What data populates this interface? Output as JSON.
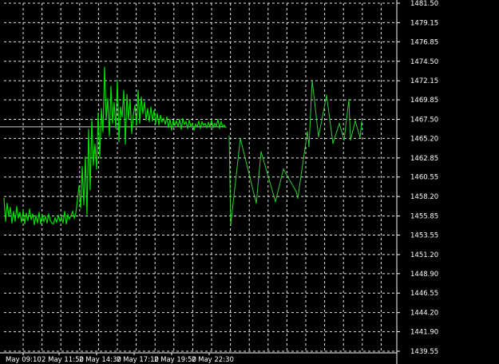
{
  "chart_data": {
    "type": "line",
    "title": "",
    "xlabel": "",
    "ylabel": "",
    "ylim": [
      1439.55,
      1481.5
    ],
    "y_ticks": [
      "1481.50",
      "1479.15",
      "1476.85",
      "1474.50",
      "1472.15",
      "1469.85",
      "1467.50",
      "1465.20",
      "1462.85",
      "1460.55",
      "1458.20",
      "1455.85",
      "1453.55",
      "1451.20",
      "1448.90",
      "1446.55",
      "1444.20",
      "1441.90",
      "1439.55"
    ],
    "x_ticks": [
      "May 09:10",
      "2 May 11:50",
      "2 May 14:30",
      "2 May 17:10",
      "2 May 19:50",
      "2 May 22:30"
    ],
    "grid": true,
    "colors": {
      "background": "#000000",
      "grid": "#ffffff",
      "price_line": "#00e000",
      "thin_line": "#33cc33",
      "horizontal_level": "#cfcfcf",
      "axis_text": "#ffffff"
    },
    "reference_level": 1466.6,
    "main_series": {
      "name": "",
      "x_index": [
        0,
        2,
        4,
        6,
        8,
        10,
        12,
        14,
        16,
        18,
        20,
        22,
        24,
        26,
        28,
        30,
        32,
        34,
        36,
        38,
        40,
        42,
        44,
        46,
        48,
        50,
        52,
        54,
        56,
        58,
        60,
        62,
        64,
        66,
        68,
        70,
        72,
        74,
        76,
        78,
        80,
        82,
        84,
        86,
        88,
        90,
        92,
        94,
        96,
        98,
        100,
        102,
        104,
        106,
        108,
        110,
        112,
        114,
        116,
        118,
        120,
        122,
        124,
        126,
        128,
        130,
        132,
        134,
        136,
        138,
        140,
        142,
        144,
        146,
        148,
        150,
        152,
        154,
        156,
        158,
        160,
        162,
        164,
        166,
        168,
        170,
        172,
        174,
        176,
        178,
        180,
        182,
        184,
        186,
        188,
        190,
        192,
        194,
        196,
        198,
        200,
        202,
        204,
        206,
        208,
        210,
        212,
        214,
        216,
        218,
        220,
        222,
        224,
        226,
        228,
        230,
        232,
        234,
        236,
        238,
        240,
        242,
        244,
        246,
        248,
        250,
        252,
        254,
        256,
        258,
        260,
        262,
        264,
        266,
        268,
        270,
        272,
        274,
        276,
        278
      ],
      "values": [
        1458.0,
        1455.2,
        1457.4,
        1455.8,
        1456.9,
        1455.0,
        1456.4,
        1455.2,
        1457.0,
        1455.6,
        1456.3,
        1455.1,
        1456.5,
        1454.9,
        1456.2,
        1455.3,
        1456.7,
        1455.4,
        1456.1,
        1454.8,
        1455.9,
        1455.0,
        1456.3,
        1454.9,
        1456.0,
        1455.2,
        1455.8,
        1455.0,
        1456.1,
        1455.3,
        1455.0,
        1454.9,
        1455.6,
        1455.1,
        1455.9,
        1455.2,
        1455.7,
        1455.0,
        1456.4,
        1454.9,
        1456.0,
        1455.5,
        1455.9,
        1456.4,
        1455.6,
        1456.2,
        1457.8,
        1459.5,
        1456.8,
        1461.8,
        1457.2,
        1463.0,
        1456.0,
        1466.3,
        1459.0,
        1467.5,
        1462.0,
        1464.5,
        1461.5,
        1468.3,
        1463.0,
        1468.8,
        1466.0,
        1473.8,
        1467.5,
        1470.0,
        1465.5,
        1471.5,
        1467.0,
        1469.5,
        1466.4,
        1472.2,
        1464.8,
        1469.0,
        1467.8,
        1471.0,
        1464.5,
        1470.5,
        1467.5,
        1469.8,
        1465.8,
        1468.0,
        1469.2,
        1466.8,
        1471.0,
        1467.0,
        1470.2,
        1468.2,
        1469.6,
        1467.4,
        1468.8,
        1467.2,
        1469.0,
        1467.3,
        1468.6,
        1467.0,
        1468.2,
        1466.8,
        1468.0,
        1467.2,
        1467.6,
        1466.9,
        1467.8,
        1466.5,
        1467.5,
        1466.2,
        1467.4,
        1466.8,
        1467.3,
        1466.6,
        1467.5,
        1466.3,
        1467.6,
        1466.9,
        1467.2,
        1466.4,
        1467.4,
        1466.7,
        1467.0,
        1466.2,
        1466.9,
        1466.6,
        1467.3,
        1466.4,
        1467.2,
        1466.8,
        1467.0,
        1466.5,
        1467.1,
        1466.6,
        1467.4,
        1466.5,
        1467.0,
        1466.7,
        1467.5,
        1466.4,
        1467.2,
        1466.6,
        1466.8,
        1466.5
      ]
    },
    "thin_series": {
      "name": "",
      "x_index": [
        282,
        284,
        296,
        316,
        322,
        340,
        350,
        366,
        368,
        380,
        382,
        386,
        394,
        404,
        412,
        420,
        426,
        432,
        434,
        440,
        446,
        448
      ],
      "values": [
        1465.5,
        1454.8,
        1465.2,
        1457.4,
        1463.6,
        1457.6,
        1461.5,
        1458.8,
        1458.0,
        1466.0,
        1464.2,
        1472.2,
        1465.4,
        1470.4,
        1464.6,
        1467.0,
        1465.0,
        1469.9,
        1465.0,
        1467.3,
        1465.3,
        1467.2
      ]
    }
  }
}
